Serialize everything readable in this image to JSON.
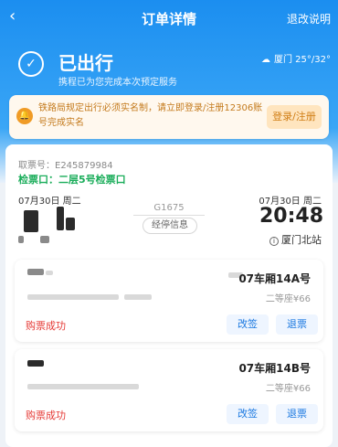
{
  "header": {
    "back_icon": "‹",
    "title": "订单详情",
    "explain_link": "退改说明"
  },
  "status": {
    "icon": "✓",
    "title": "已出行",
    "subtitle": "携程已为您完成本次预定服务",
    "weather_icon": "☁",
    "weather": "厦门 25°/32°"
  },
  "notice": {
    "icon": "🔔",
    "text": "铁路局规定出行必须实名制，请立即登录/注册12306账号完成实名",
    "login_button": "登录/注册"
  },
  "ticket": {
    "ticket_no": "取票号：E245879984",
    "gate": "检票口：二层5号检票口",
    "depart_date": "07月30日 周二",
    "arrive_date": "07月30日 周二",
    "train_no": "G1675",
    "stops_button": "经停信息",
    "arrive_time": "20:48",
    "arrive_station": "厦门北站",
    "info_icon": "i"
  },
  "passengers": [
    {
      "seat": "07车厢14A号",
      "seat_class": "二等座¥66",
      "status": "购票成功",
      "change_button": "改签",
      "refund_button": "退票"
    },
    {
      "seat": "07车厢14B号",
      "seat_class": "二等座¥66",
      "status": "购票成功",
      "change_button": "改签",
      "refund_button": "退票"
    }
  ]
}
